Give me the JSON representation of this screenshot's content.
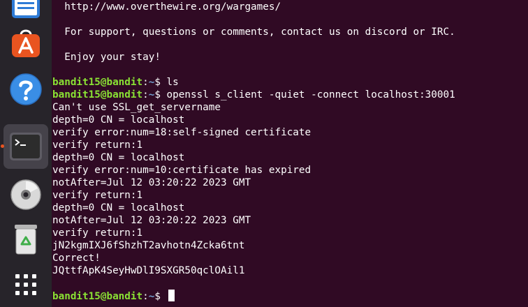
{
  "dock": {
    "items": [
      {
        "name": "text-editor"
      },
      {
        "name": "software-store"
      },
      {
        "name": "help"
      },
      {
        "name": "terminal"
      },
      {
        "name": "disc"
      },
      {
        "name": "trash"
      },
      {
        "name": "show-apps"
      }
    ],
    "terminal_running": true
  },
  "terminal": {
    "lines": [
      {
        "text": "  http://www.overthewire.org/wargames/"
      },
      {
        "text": ""
      },
      {
        "text": "  For support, questions or comments, contact us on discord or IRC."
      },
      {
        "text": ""
      },
      {
        "text": "  Enjoy your stay!"
      },
      {
        "text": ""
      },
      {
        "user": "bandit15@bandit",
        "path": "~",
        "symbol": "$",
        "command": " ls"
      },
      {
        "user": "bandit15@bandit",
        "path": "~",
        "symbol": "$",
        "command": " openssl s_client -quiet -connect localhost:30001"
      },
      {
        "text": "Can't use SSL_get_servername"
      },
      {
        "text": "depth=0 CN = localhost"
      },
      {
        "text": "verify error:num=18:self-signed certificate"
      },
      {
        "text": "verify return:1"
      },
      {
        "text": "depth=0 CN = localhost"
      },
      {
        "text": "verify error:num=10:certificate has expired"
      },
      {
        "text": "notAfter=Jul 12 03:20:22 2023 GMT"
      },
      {
        "text": "verify return:1"
      },
      {
        "text": "depth=0 CN = localhost"
      },
      {
        "text": "notAfter=Jul 12 03:20:22 2023 GMT"
      },
      {
        "text": "verify return:1"
      },
      {
        "text": "jN2kgmIXJ6fShzhT2avhotn4Zcka6tnt"
      },
      {
        "text": "Correct!"
      },
      {
        "text": "JQttfApK4SeyHwDlI9SXGR50qclOAil1"
      },
      {
        "text": ""
      },
      {
        "user": "bandit15@bandit",
        "path": "~",
        "symbol": "$",
        "command": " ",
        "cursor": true
      }
    ]
  }
}
